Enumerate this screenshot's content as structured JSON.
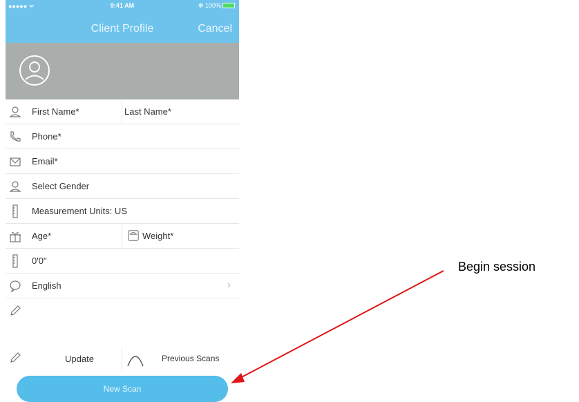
{
  "status": {
    "signal": "●●●●● ᯤ",
    "time": "9:41 AM",
    "battery": "✻ 100%"
  },
  "header": {
    "title": "Client Profile",
    "cancel_label": "Cancel"
  },
  "form": {
    "first_name": "First Name*",
    "last_name": "Last Name*",
    "phone": "Phone*",
    "email": "Email*",
    "gender": "Select Gender",
    "units": "Measurement Units: US",
    "age": "Age*",
    "weight": "Weight*",
    "height": "0'0\"",
    "language": "English"
  },
  "actions": {
    "update": "Update",
    "previous_scans": "Previous Scans",
    "new_scan": "New Scan"
  },
  "annotation": {
    "text": "Begin session",
    "arrow_color": "#e01515"
  },
  "colors": {
    "header": "#6ec3ec",
    "button": "#55bdea",
    "avatar_band": "#a9adab"
  }
}
